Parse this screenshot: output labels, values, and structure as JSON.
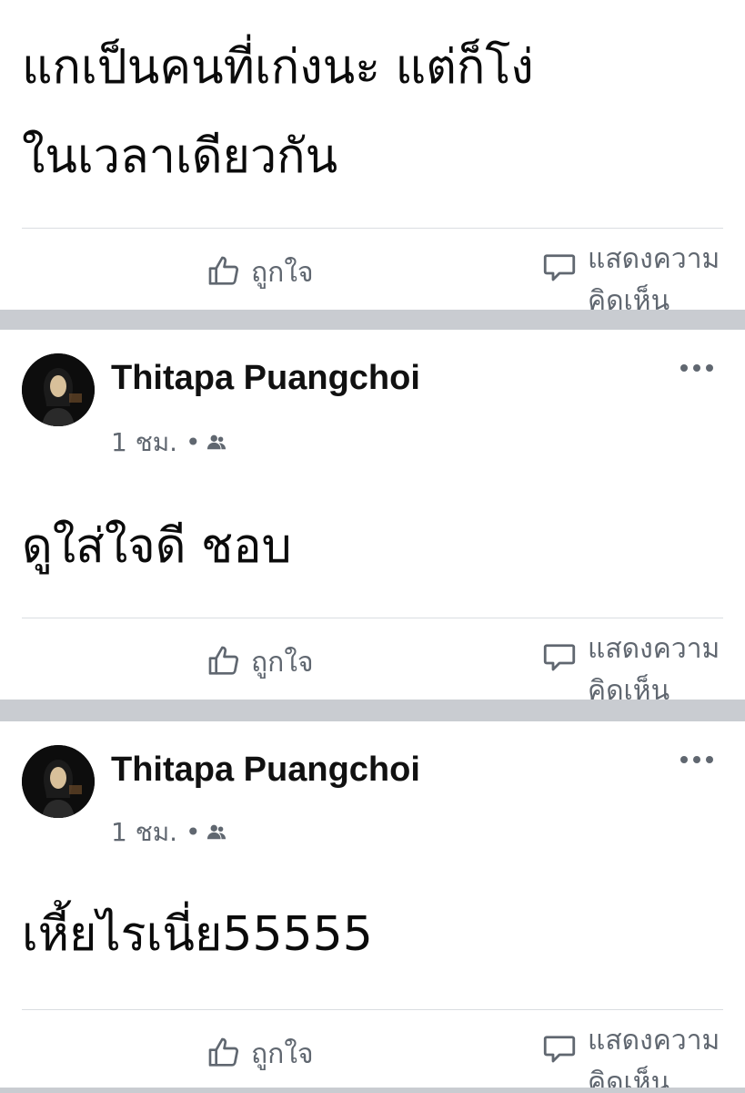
{
  "posts": [
    {
      "text_lines": [
        "แกเป็นคนที่เก่งนะ แต่ก็โง่",
        "ในเวลาเดียวกัน"
      ],
      "like_label": "ถูกใจ",
      "comment_label": "แสดงความคิดเห็น"
    },
    {
      "author": "Thitapa Puangchoi",
      "time": "1 ชม. •",
      "text": "ดูใส่ใจดี ชอบ",
      "like_label": "ถูกใจ",
      "comment_label": "แสดงความคิดเห็น"
    },
    {
      "author": "Thitapa Puangchoi",
      "time": "1 ชม. •",
      "text": "เหี้ยไรเนี่ย55555",
      "like_label": "ถูกใจ",
      "comment_label": "แสดงความคิดเห็น"
    }
  ],
  "icons": {
    "like": "thumbs-up-icon",
    "comment": "comment-bubble-icon",
    "audience": "friends-icon",
    "more": "more-options-icon"
  },
  "colors": {
    "separator": "#c9ccd1",
    "secondary_text": "#606770",
    "divider": "#dadde1"
  }
}
